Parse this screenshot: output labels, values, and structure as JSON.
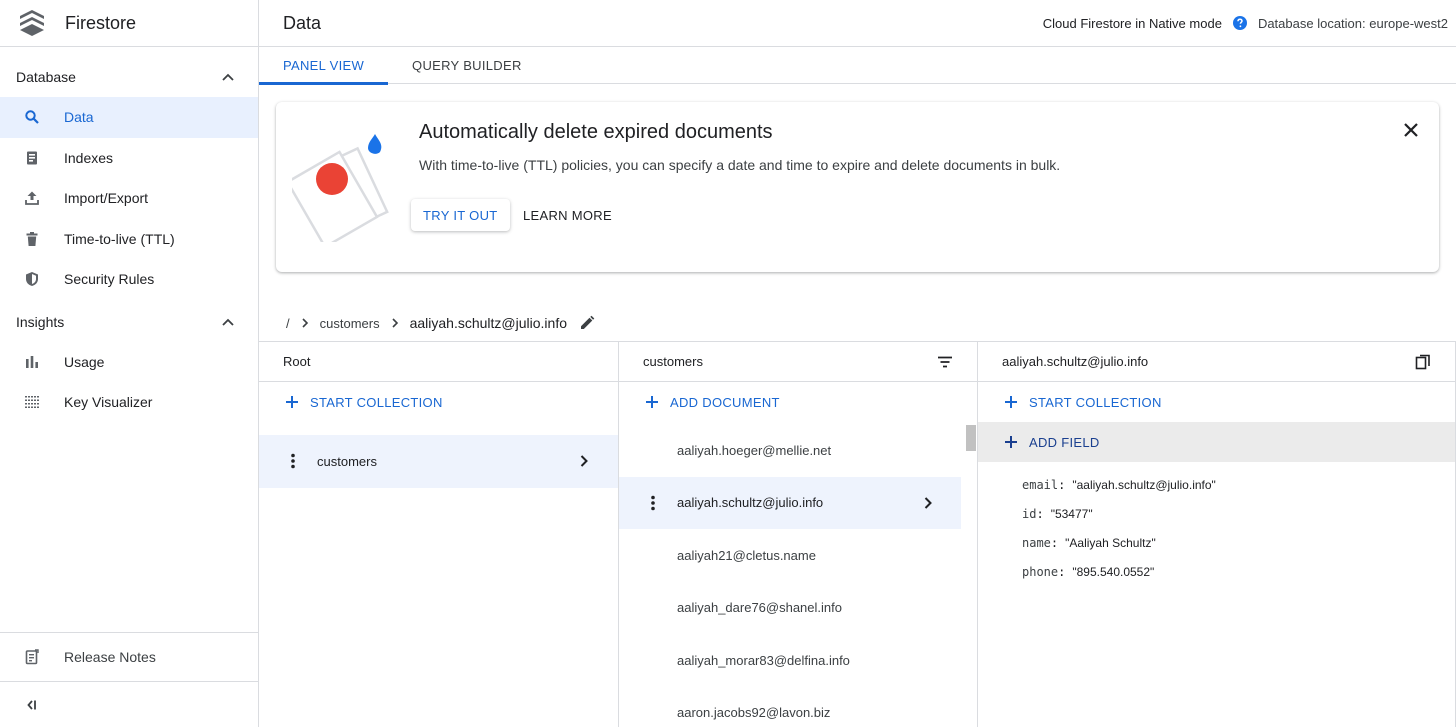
{
  "colors": {
    "accent": "#1967d2",
    "selected_bg": "#e8f0fe",
    "banner_red": "#ea4335",
    "banner_blue": "#1a73e8"
  },
  "app": {
    "title": "Firestore"
  },
  "sidebar": {
    "database_label": "Database",
    "insights_label": "Insights",
    "database_items": [
      {
        "label": "Data",
        "icon": "search-icon"
      },
      {
        "label": "Indexes",
        "icon": "indexes-icon"
      },
      {
        "label": "Import/Export",
        "icon": "upload-icon"
      },
      {
        "label": "Time-to-live (TTL)",
        "icon": "trash-icon"
      },
      {
        "label": "Security Rules",
        "icon": "shield-icon"
      }
    ],
    "insights_items": [
      {
        "label": "Usage",
        "icon": "bar-chart-icon"
      },
      {
        "label": "Key Visualizer",
        "icon": "grid-icon"
      }
    ],
    "release_notes": "Release Notes"
  },
  "header": {
    "title": "Data",
    "mode": "Cloud Firestore in Native mode",
    "location": "Database location: europe-west2"
  },
  "tabs": [
    {
      "label": "PANEL VIEW"
    },
    {
      "label": "QUERY BUILDER"
    }
  ],
  "banner": {
    "title": "Automatically delete expired documents",
    "description": "With time-to-live (TTL) policies, you can specify a date and time to expire and delete documents in bulk.",
    "try_label": "TRY IT OUT",
    "learn_label": "LEARN MORE"
  },
  "breadcrumb": {
    "root": "/",
    "collection": "customers",
    "document": "aaliyah.schultz@julio.info"
  },
  "panels": {
    "root": {
      "title": "Root",
      "action": "START COLLECTION",
      "items": [
        "customers"
      ]
    },
    "collection": {
      "title": "customers",
      "action": "ADD DOCUMENT",
      "items": [
        "aaliyah.hoeger@mellie.net",
        "aaliyah.schultz@julio.info",
        "aaliyah21@cletus.name",
        "aaliyah_dare76@shanel.info",
        "aaliyah_morar83@delfina.info",
        "aaron.jacobs92@lavon.biz"
      ]
    },
    "document": {
      "title": "aaliyah.schultz@julio.info",
      "action_collection": "START COLLECTION",
      "action_field": "ADD FIELD",
      "fields": [
        {
          "key": "email",
          "value": "\"aaliyah.schultz@julio.info\""
        },
        {
          "key": "id",
          "value": "\"53477\""
        },
        {
          "key": "name",
          "value": "\"Aaliyah Schultz\""
        },
        {
          "key": "phone",
          "value": "\"895.540.0552\""
        }
      ]
    }
  }
}
